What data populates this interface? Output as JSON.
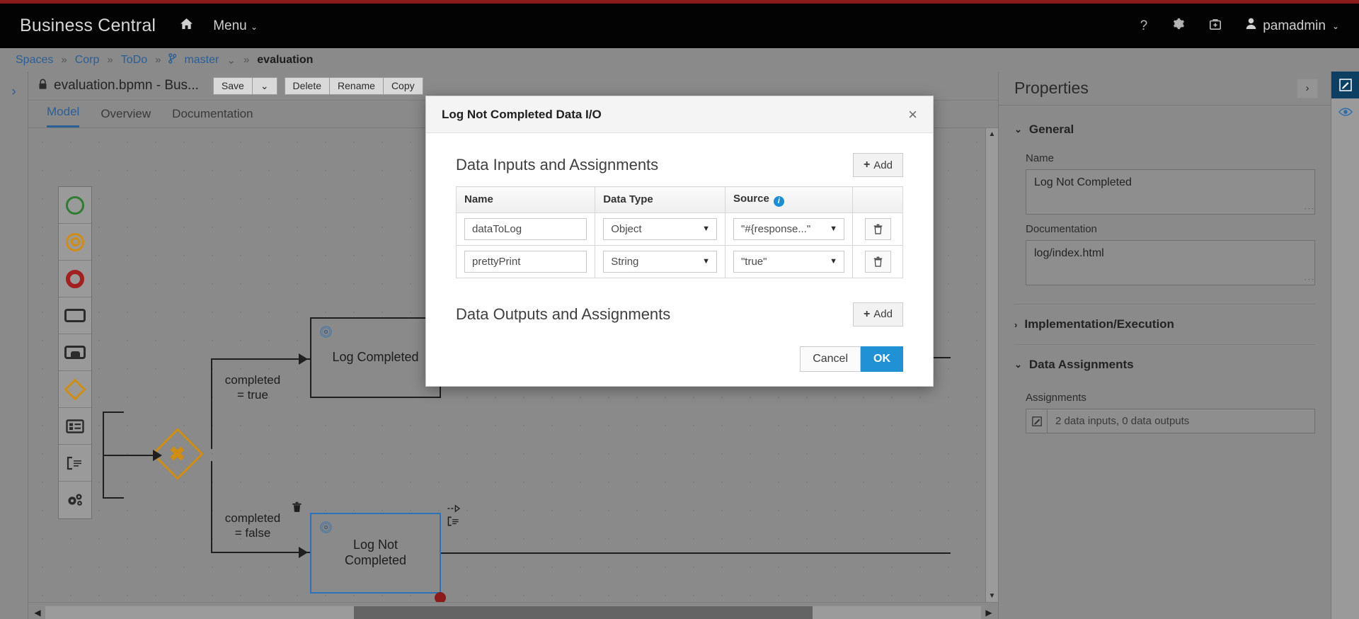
{
  "masthead": {
    "brand": "Business Central",
    "home_icon": "home-icon",
    "menu_label": "Menu",
    "caret": "⌄",
    "help_icon": "?",
    "gear_icon": "⚙",
    "kit_icon": "⛑",
    "user_name": "pamadmin"
  },
  "breadcrumb": {
    "items": [
      {
        "label": "Spaces",
        "current": false
      },
      {
        "label": "Corp",
        "current": false
      },
      {
        "label": "ToDo",
        "current": false
      },
      {
        "label": "master",
        "current": false
      },
      {
        "label": "evaluation",
        "current": true
      }
    ],
    "separator": "»",
    "branch_glyph": "⎇"
  },
  "editor": {
    "rail_arrow": "›",
    "lock_icon": "🔒",
    "file_title": "evaluation.bpmn - Bus...",
    "save_label": "Save",
    "save_caret": "⌄",
    "delete_label": "Delete",
    "rename_label": "Rename",
    "copy_label": "Copy",
    "tabs": [
      {
        "label": "Model",
        "active": true
      },
      {
        "label": "Overview",
        "active": false
      },
      {
        "label": "Documentation",
        "active": false
      }
    ]
  },
  "palette": {
    "items": [
      {
        "name": "start-event-icon"
      },
      {
        "name": "intermediate-event-icon"
      },
      {
        "name": "end-event-icon"
      },
      {
        "name": "task-icon"
      },
      {
        "name": "subprocess-icon"
      },
      {
        "name": "gateway-icon"
      },
      {
        "name": "data-object-icon"
      },
      {
        "name": "text-annotation-icon"
      },
      {
        "name": "service-tasks-icon"
      }
    ]
  },
  "diagram": {
    "gateway_glyph": "✖",
    "nodes": [
      {
        "label": "Log Completed",
        "selected": false
      },
      {
        "label": "Log Not\nCompleted",
        "selected": true
      }
    ],
    "node_completed_label": "Log Completed",
    "node_notcompleted_label": "Log Not Completed",
    "edge_true_label": "completed\n= true",
    "edge_false_label": "completed\n= false",
    "trash_icon": "🗑",
    "arrow_icon": "⇢",
    "annotation_icon": "⎇"
  },
  "scroll": {
    "up_arrow": "▲",
    "down_arrow": "▼",
    "left_arrow": "◀",
    "right_arrow": "▶"
  },
  "properties": {
    "title": "Properties",
    "expand_icon": "›",
    "sections": [
      {
        "label": "General",
        "expanded": true
      },
      {
        "label": "Implementation/Execution",
        "expanded": false
      },
      {
        "label": "Data Assignments",
        "expanded": true
      }
    ],
    "chev_down": "⌄",
    "chev_right": "›",
    "name_label": "Name",
    "name_value": "Log Not Completed",
    "documentation_label": "Documentation",
    "documentation_value": "log/index.html",
    "implementation_label": "Implementation/Execution",
    "data_assignments_label": "Data Assignments",
    "assignments_label": "Assignments",
    "assignments_value": "2 data inputs, 0 data outputs",
    "assignments_edit_icon": "✎"
  },
  "right_rail": {
    "edit_icon": "✎",
    "eye_icon": "◉"
  },
  "modal": {
    "title": "Log Not Completed Data I/O",
    "close_icon": "×",
    "inputs_section_title": "Data Inputs and Assignments",
    "outputs_section_title": "Data Outputs and Assignments",
    "add_label": "Add",
    "add_plus": "+",
    "info_icon": "i",
    "dropdown_caret": "▼",
    "trash_icon": "🗑",
    "columns": [
      "Name",
      "Data Type",
      "Source",
      ""
    ],
    "inputs": [
      {
        "name": "dataToLog",
        "data_type": "Object",
        "source": "\"#{response...\""
      },
      {
        "name": "prettyPrint",
        "data_type": "String",
        "source": "\"true\""
      }
    ],
    "outputs": [],
    "cancel_label": "Cancel",
    "ok_label": "OK"
  },
  "colors": {
    "accent_red": "#8b1a1a",
    "masthead_bg": "#030303",
    "link_blue": "#2c5f94",
    "ok_blue": "#2191d6",
    "info_blue": "#1a8fd8",
    "selection_blue": "#2c72b8",
    "start_green": "#2e7d32",
    "end_red": "#a32020",
    "gateway_orange": "#cf8d12"
  }
}
